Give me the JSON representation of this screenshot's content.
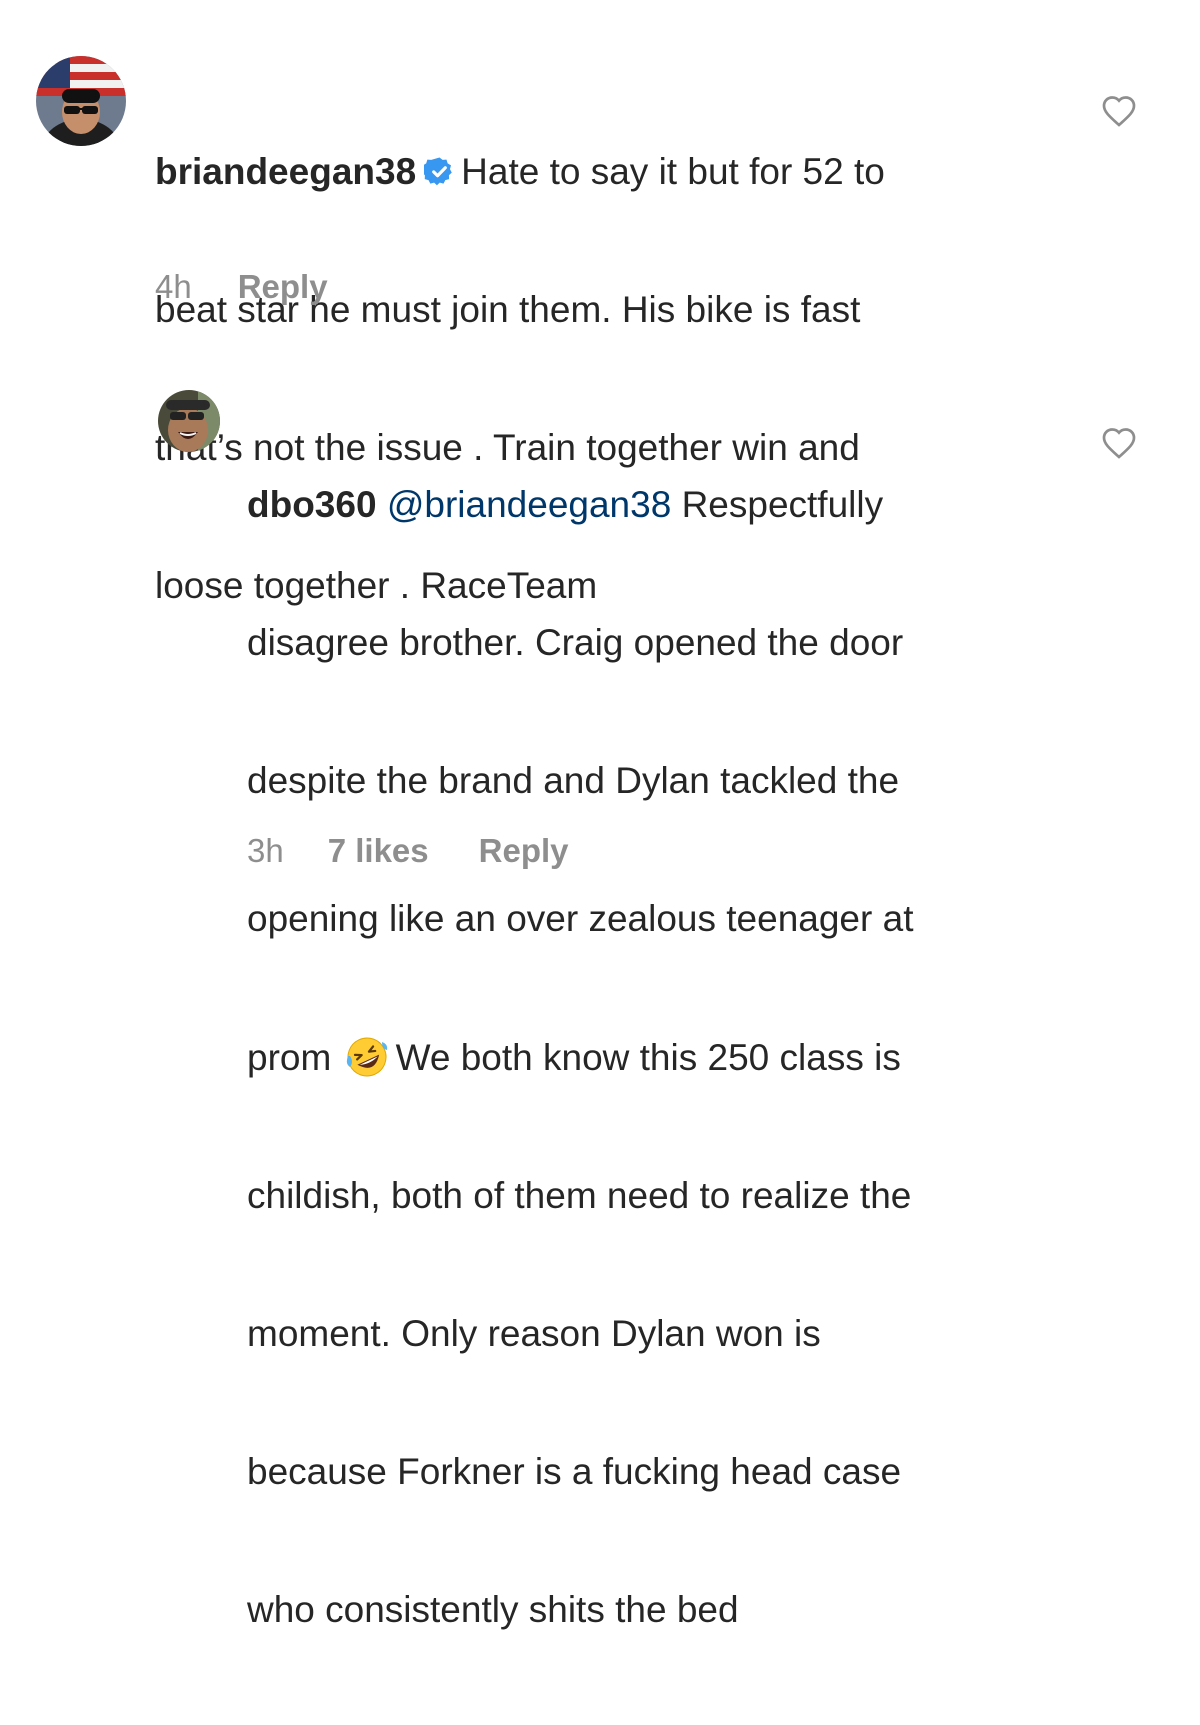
{
  "comments": [
    {
      "username": "briandeegan38",
      "verified": true,
      "lines": [
        "Hate to say it but for 52 to",
        "beat star he must join them. His bike is fast",
        "that’s not the issue .  Train together win and",
        "loose together . RaceTeam"
      ],
      "time": "4h",
      "reply_label": "Reply",
      "icons": {
        "avatar": "avatar-photo",
        "verified": "verified-badge-icon",
        "like": "heart-outline-icon"
      }
    },
    {
      "username": "dbo360",
      "mention": "@briandeegan38",
      "first_line_text": "Respectfully",
      "lines": [
        "disagree brother. Craig opened the door",
        "despite the brand and Dylan tackled the",
        "opening like an over zealous teenager at"
      ],
      "prom_word": "prom",
      "emoji_name": "rolling-on-the-floor-laughing-emoji",
      "after_emoji": "We both know this 250 class is",
      "lines_after": [
        "childish, both of them need to realize the",
        "moment. Only reason Dylan won is",
        "because Forkner is a fucking head case",
        "who consistently shits the bed"
      ],
      "time": "3h",
      "likes_label": "7 likes",
      "reply_label": "Reply",
      "icons": {
        "avatar": "avatar-photo",
        "like": "heart-outline-icon"
      }
    }
  ],
  "colors": {
    "text": "#262626",
    "meta": "#8e8e8e",
    "mention": "#00376b",
    "verified": "#3897f0",
    "heart_outline": "#8e8e8e"
  }
}
